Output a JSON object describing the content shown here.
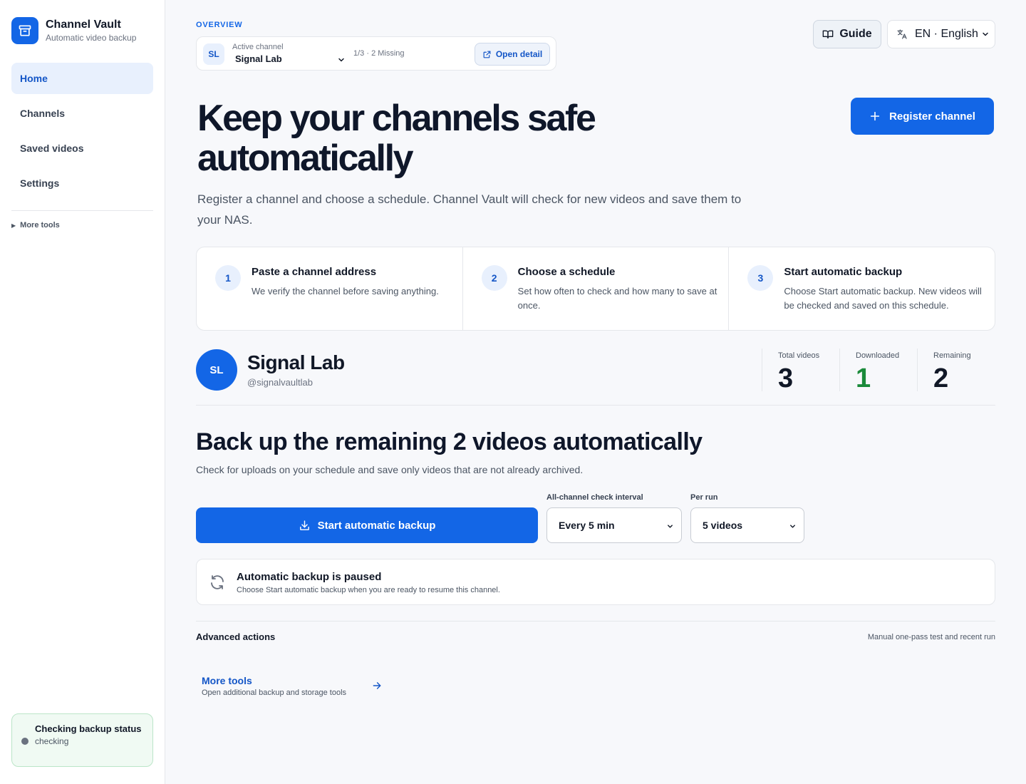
{
  "brand": {
    "name": "Channel Vault",
    "subtitle": "Automatic video backup"
  },
  "sidebar": {
    "items": [
      {
        "label": "Home",
        "active": true
      },
      {
        "label": "Channels",
        "active": false
      },
      {
        "label": "Saved videos",
        "active": false
      },
      {
        "label": "Settings",
        "active": false
      }
    ],
    "more_tools": "More tools",
    "status": {
      "title": "Checking backup status",
      "subtitle": "checking"
    }
  },
  "header": {
    "overview_label": "OVERVIEW",
    "active_channel": {
      "label": "Active channel",
      "avatar": "SL",
      "name": "Signal Lab",
      "count": "1/3 · 2 Missing",
      "open_detail": "Open detail"
    },
    "guide": "Guide",
    "language": "EN · English"
  },
  "hero": {
    "title": "Keep your channels safe automatically",
    "description": "Register a channel and choose a schedule. Channel Vault will check for new videos and save them to your NAS.",
    "register_button": "Register channel"
  },
  "steps": [
    {
      "num": "1",
      "title": "Paste a channel address",
      "desc": "We verify the channel before saving anything."
    },
    {
      "num": "2",
      "title": "Choose a schedule",
      "desc": "Set how often to check and how many to save at once."
    },
    {
      "num": "3",
      "title": "Start automatic backup",
      "desc": "Choose Start automatic backup. New videos will be checked and saved on this schedule."
    }
  ],
  "channel": {
    "avatar": "SL",
    "name": "Signal Lab",
    "handle": "@signalvaultlab",
    "stats": [
      {
        "label": "Total videos",
        "value": "3"
      },
      {
        "label": "Downloaded",
        "value": "1"
      },
      {
        "label": "Remaining",
        "value": "2"
      }
    ]
  },
  "backup": {
    "title": "Back up the remaining 2 videos automatically",
    "description": "Check for uploads on your schedule and save only videos that are not already archived.",
    "start_button": "Start automatic backup",
    "interval_label": "All-channel check interval",
    "interval_value": "Every 5 min",
    "per_run_label": "Per run",
    "per_run_value": "5 videos",
    "paused_title": "Automatic backup is paused",
    "paused_sub": "Choose Start automatic backup when you are ready to resume this channel."
  },
  "advanced": {
    "title": "Advanced actions",
    "note": "Manual one-pass test and recent run",
    "more_tools_title": "More tools",
    "more_tools_sub": "Open additional backup and storage tools"
  },
  "colors": {
    "accent": "#1366e6",
    "accent_dark": "#1456c7",
    "success": "#1a8a3a"
  }
}
